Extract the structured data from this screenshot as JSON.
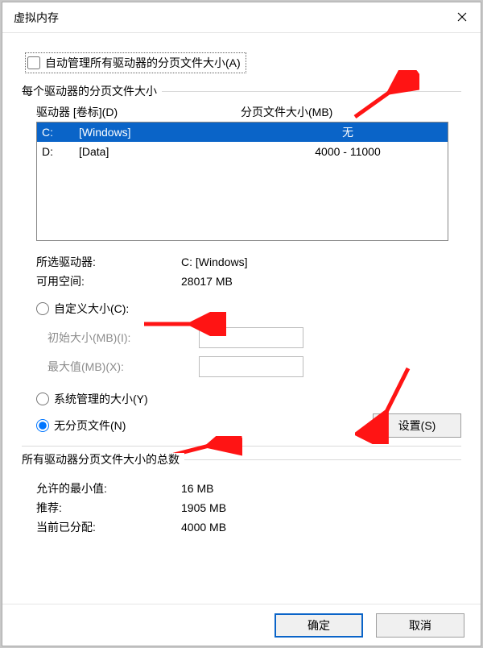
{
  "title": "虚拟内存",
  "autoManage": {
    "label": "自动管理所有驱动器的分页文件大小(A)"
  },
  "driveSection": {
    "title": "每个驱动器的分页文件大小",
    "headerDrive": "驱动器 [卷标](D)",
    "headerSize": "分页文件大小(MB)",
    "rows": [
      {
        "letter": "C:",
        "label": "[Windows]",
        "size": "无",
        "selected": true
      },
      {
        "letter": "D:",
        "label": "[Data]",
        "size": "4000 - 11000",
        "selected": false
      }
    ]
  },
  "selected": {
    "driveLabel": "所选驱动器:",
    "driveValue": "C:  [Windows]",
    "spaceLabel": "可用空间:",
    "spaceValue": "28017 MB"
  },
  "custom": {
    "label": "自定义大小(C):",
    "initialLabel": "初始大小(MB)(I):",
    "maxLabel": "最大值(MB)(X):"
  },
  "sysManaged": {
    "label": "系统管理的大小(Y)"
  },
  "noPaging": {
    "label": "无分页文件(N)"
  },
  "setButton": "设置(S)",
  "totals": {
    "title": "所有驱动器分页文件大小的总数",
    "minLabel": "允许的最小值:",
    "minValue": "16 MB",
    "recLabel": "推荐:",
    "recValue": "1905 MB",
    "curLabel": "当前已分配:",
    "curValue": "4000 MB"
  },
  "ok": "确定",
  "cancel": "取消"
}
